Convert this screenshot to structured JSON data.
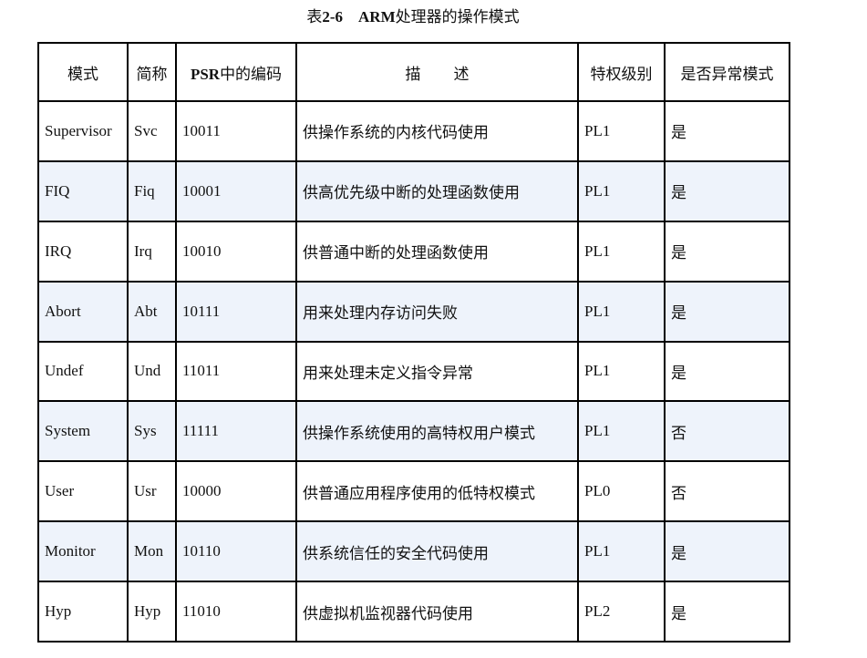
{
  "caption": {
    "prefix": "表",
    "number": "2-6",
    "arm": "ARM",
    "title_rest": "处理器的操作模式"
  },
  "table": {
    "headers": {
      "mode": "模式",
      "abbr": "简称",
      "psr_bold": "PSR",
      "psr_rest": "中的编码",
      "desc_a": "描",
      "desc_b": "述",
      "priv": "特权级别",
      "exception": "是否异常模式"
    },
    "rows": [
      {
        "mode": "Supervisor",
        "abbr": "Svc",
        "code": "10011",
        "desc": "供操作系统的内核代码使用",
        "priv": "PL1",
        "exception": "是"
      },
      {
        "mode": "FIQ",
        "abbr": "Fiq",
        "code": "10001",
        "desc": "供高优先级中断的处理函数使用",
        "priv": "PL1",
        "exception": "是"
      },
      {
        "mode": "IRQ",
        "abbr": "Irq",
        "code": "10010",
        "desc": "供普通中断的处理函数使用",
        "priv": "PL1",
        "exception": "是"
      },
      {
        "mode": "Abort",
        "abbr": "Abt",
        "code": "10111",
        "desc": "用来处理内存访问失败",
        "priv": "PL1",
        "exception": "是"
      },
      {
        "mode": "Undef",
        "abbr": "Und",
        "code": "11011",
        "desc": "用来处理未定义指令异常",
        "priv": "PL1",
        "exception": "是"
      },
      {
        "mode": "System",
        "abbr": "Sys",
        "code": "11111",
        "desc": "供操作系统使用的高特权用户模式",
        "priv": "PL1",
        "exception": "否"
      },
      {
        "mode": "User",
        "abbr": "Usr",
        "code": "10000",
        "desc": "供普通应用程序使用的低特权模式",
        "priv": "PL0",
        "exception": "否"
      },
      {
        "mode": "Monitor",
        "abbr": "Mon",
        "code": "10110",
        "desc": "供系统信任的安全代码使用",
        "priv": "PL1",
        "exception": "是"
      },
      {
        "mode": "Hyp",
        "abbr": "Hyp",
        "code": "11010",
        "desc": "供虚拟机监视器代码使用",
        "priv": "PL2",
        "exception": "是"
      }
    ]
  },
  "colors": {
    "alt_row_background": "#eef3fb",
    "border": "#000000"
  }
}
